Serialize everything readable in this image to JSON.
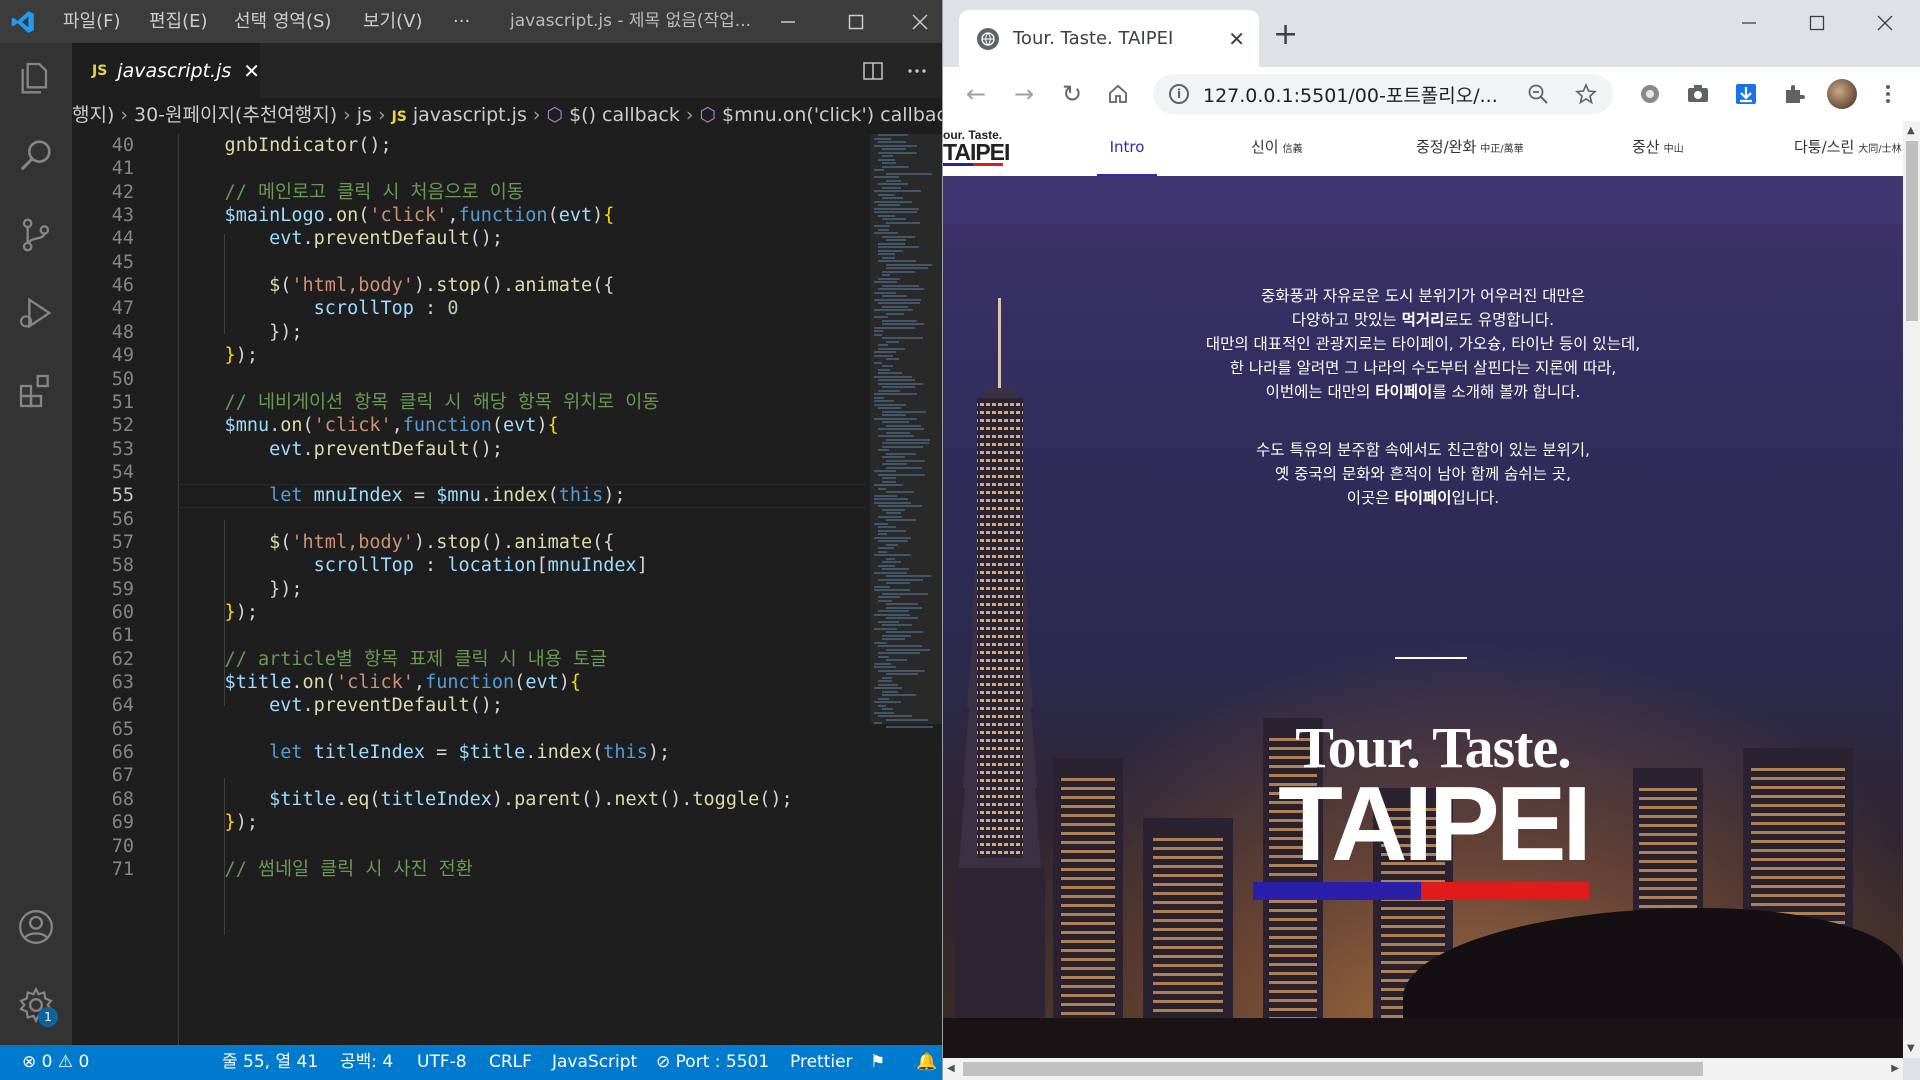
{
  "vscode": {
    "menu": [
      "파일(F)",
      "편집(E)",
      "선택 영역(S)",
      "보기(V)",
      "···"
    ],
    "window_title": "javascript.js - 제목 없음(작업...",
    "tab": {
      "badge": "JS",
      "name": "javascript.js",
      "close": "✕"
    },
    "breadcrumb": {
      "seg1": "행지)",
      "seg2": "30-원페이지(추천여행지)",
      "seg3": "js",
      "seg4_badge": "JS",
      "seg4": "javascript.js",
      "seg5": "$() callback",
      "seg6": "$mnu.on('click') callbac"
    },
    "active_line": 55,
    "lines": [
      40,
      41,
      42,
      43,
      44,
      45,
      46,
      47,
      48,
      49,
      50,
      51,
      52,
      53,
      54,
      55,
      56,
      57,
      58,
      59,
      60,
      61,
      62,
      63,
      64,
      65,
      66,
      67,
      68,
      69,
      70,
      71
    ],
    "status": {
      "errors": "0",
      "warnings": "0",
      "position": "줄 55, 열 41",
      "spaces": "공백: 4",
      "encoding": "UTF-8",
      "eol": "CRLF",
      "language": "JavaScript",
      "port": "Port : 5501",
      "formatter": "Prettier"
    },
    "settings_badge": "1"
  },
  "chrome": {
    "tab_title": "Tour. Taste. TAIPEI",
    "tab_close": "✕",
    "new_tab": "+",
    "url": "127.0.0.1:5501/00-포트폴리오/...",
    "site": {
      "logo_small": "our. Taste.",
      "logo_big": "TAIPEI",
      "nav": [
        {
          "label": "Intro",
          "sub": ""
        },
        {
          "label": "신이",
          "sub": "信義"
        },
        {
          "label": "중정/완화",
          "sub": "中正/萬華"
        },
        {
          "label": "중산",
          "sub": "中山"
        },
        {
          "label": "다퉁/스린",
          "sub": "大同/士林"
        }
      ],
      "intro_p1": [
        "중화풍과 자유로운 도시 분위기가 어우러진 대만은",
        "다양하고 맛있는 ",
        "먹거리",
        "로도 유명합니다.",
        "대만의 대표적인 관광지로는 타이페이, 가오슝, 타이난 등이 있는데,",
        "한 나라를 알려면 그 나라의 수도부터 살핀다는 지론에 따라,",
        "이번에는 대만의 ",
        "타이페이",
        "를 소개해 볼까 합니다."
      ],
      "intro_p2": [
        "수도 특유의 분주함 속에서도 친근함이 있는 분위기,",
        "옛 중국의 문화와 흔적이 남아 함께 숨쉬는 곳,",
        "이곳은 ",
        "타이페이",
        "입니다."
      ],
      "title_line1": "Tour. Taste.",
      "title_line2": "TAIPEI",
      "accent_colors": {
        "blue": "#2a1fa8",
        "red": "#e01b1b"
      }
    }
  }
}
